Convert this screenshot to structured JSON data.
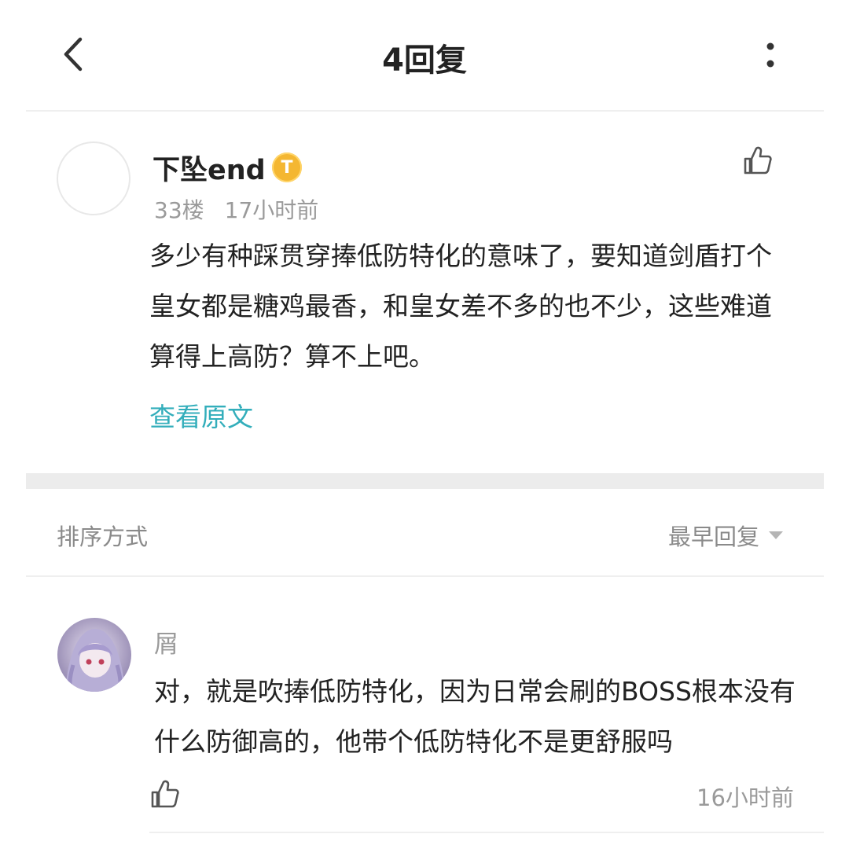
{
  "header": {
    "title": "4回复",
    "back_icon": "chevron-left-icon",
    "more_icon": "more-vertical-icon"
  },
  "post": {
    "username": "下坠end",
    "badge_text": "T",
    "floor": "33楼",
    "time": "17小时前",
    "content": "多少有种踩贯穿捧低防特化的意味了，要知道剑盾打个皇女都是糖鸡最香，和皇女差不多的也不少，这些难道算得上高防？算不上吧。",
    "view_original": "查看原文",
    "like_icon": "thumbs-up-icon"
  },
  "sort": {
    "label": "排序方式",
    "selected": "最早回复"
  },
  "reply": {
    "username": "屑",
    "content": "对，就是吹捧低防特化，因为日常会刷的BOSS根本没有什么防御高的，他带个低防特化不是更舒服吗",
    "time": "16小时前",
    "like_icon": "thumbs-up-icon"
  },
  "colors": {
    "accent": "#33aebb",
    "badge": "#f4b732",
    "muted": "#9a9a9a",
    "divider": "#efefef"
  }
}
